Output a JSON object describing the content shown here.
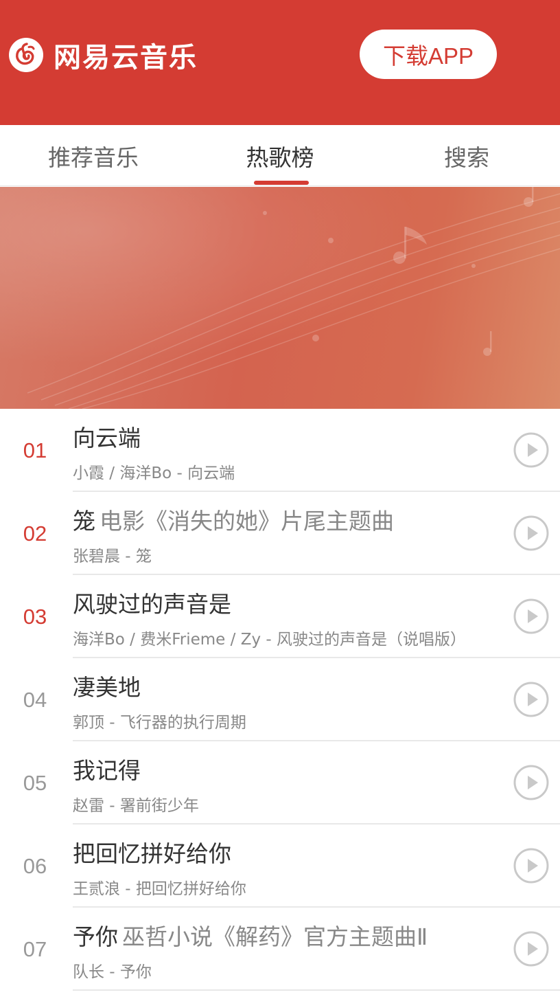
{
  "header": {
    "app_name": "网易云音乐",
    "download_label": "下载APP",
    "brand_color": "#d43c33",
    "logo_icon": "netease-music-logo-icon"
  },
  "tabs": [
    {
      "label": "推荐音乐",
      "active": false
    },
    {
      "label": "热歌榜",
      "active": true
    },
    {
      "label": "搜索",
      "active": false
    }
  ],
  "songs": [
    {
      "rank": "01",
      "title": "向云端",
      "alia": "",
      "subtitle": "小霞 / 海洋Bo - 向云端"
    },
    {
      "rank": "02",
      "title": "笼",
      "alia": "电影《消失的她》片尾主题曲",
      "subtitle": "张碧晨 - 笼"
    },
    {
      "rank": "03",
      "title": "风驶过的声音是",
      "alia": "",
      "subtitle": "海洋Bo / 费米Frieme / Zy - 风驶过的声音是（说唱版）"
    },
    {
      "rank": "04",
      "title": "凄美地",
      "alia": "",
      "subtitle": "郭顶 - 飞行器的执行周期"
    },
    {
      "rank": "05",
      "title": "我记得",
      "alia": "",
      "subtitle": "赵雷 - 署前街少年"
    },
    {
      "rank": "06",
      "title": "把回忆拼好给你",
      "alia": "",
      "subtitle": "王贰浪 - 把回忆拼好给你"
    },
    {
      "rank": "07",
      "title": "予你",
      "alia": "巫哲小说《解药》官方主题曲Ⅱ",
      "subtitle": "队长 - 予你"
    }
  ]
}
